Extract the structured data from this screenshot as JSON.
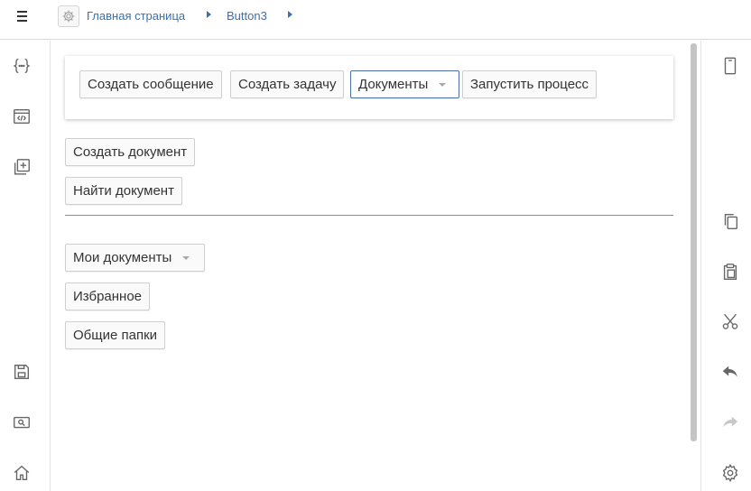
{
  "header": {
    "menu_icon": "hamburger-icon",
    "settings_icon": "gear-icon",
    "breadcrumbs": [
      "Главная страница",
      "Button3"
    ]
  },
  "left_rail": {
    "icons": [
      "braces-icon",
      "code-window-icon",
      "add-library-icon",
      "save-icon",
      "preview-icon",
      "home-icon"
    ]
  },
  "right_rail": {
    "icons": [
      "phone-icon",
      "copy-icon",
      "paste-icon",
      "cut-icon",
      "undo-icon",
      "redo-icon",
      "settings-gear-icon"
    ]
  },
  "panel": {
    "buttons": [
      "Создать сообщение",
      "Создать задачу",
      "Документы",
      "Запустить процесс"
    ]
  },
  "main": {
    "create_document": "Создать документ",
    "find_document": "Найти документ",
    "my_documents": "Мои документы",
    "favorites": "Избранное",
    "shared_folders": "Общие папки"
  },
  "colors": {
    "accent": "#3e6fa8",
    "active_border": "#4a6fa5"
  }
}
